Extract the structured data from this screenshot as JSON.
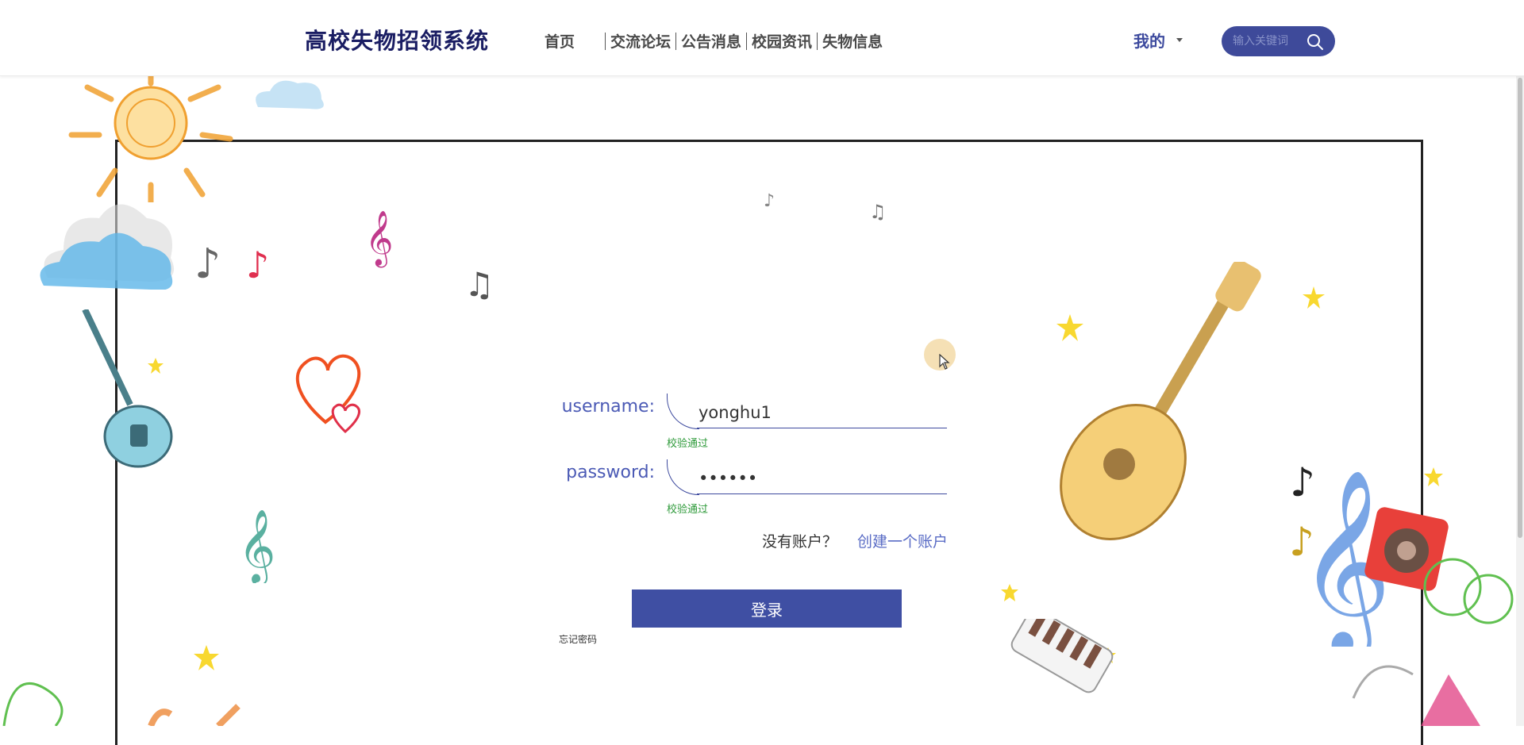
{
  "header": {
    "brand": "高校失物招领系统",
    "nav": [
      "首页",
      "交流论坛",
      "公告消息",
      "校园资讯",
      "失物信息"
    ],
    "user_menu": "我的",
    "search_placeholder": "输入关键词"
  },
  "login": {
    "username_label": "username:",
    "username_value": "yonghu1",
    "username_hint": "校验通过",
    "password_label": "password:",
    "password_value": "••••••",
    "password_hint": "校验通过",
    "no_account": "没有账户？",
    "create_account": "创建一个账户",
    "login_button": "登录",
    "forgot_password": "忘记密码"
  },
  "colors": {
    "brand": "#1a1d63",
    "accent": "#3f4fa3",
    "link": "#5a6cc5",
    "hint": "#2e9a3a"
  },
  "icons": [
    "search-icon",
    "chevron-down-icon",
    "cursor-icon"
  ]
}
